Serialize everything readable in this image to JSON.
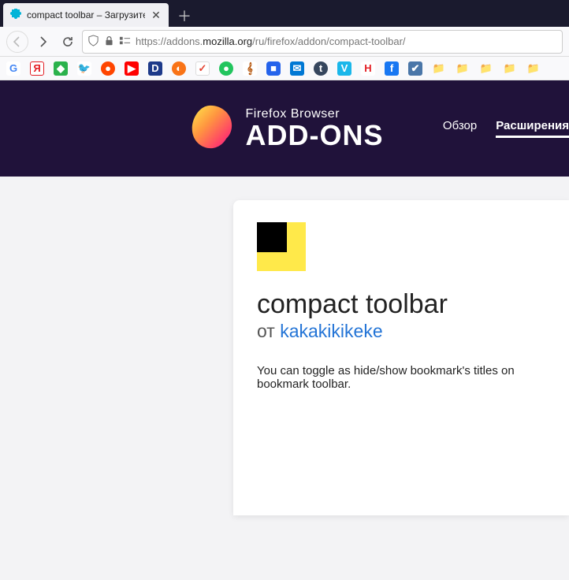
{
  "tab": {
    "title": "compact toolbar – Загрузите это"
  },
  "toolbar": {
    "url_prefix": "https://addons.",
    "url_domain": "mozilla.org",
    "url_path": "/ru/firefox/addon/compact-toolbar/"
  },
  "header": {
    "brand_line1": "Firefox Browser",
    "brand_line2": "ADD-ONS",
    "nav": {
      "overview": "Обзор",
      "extensions": "Расширения"
    }
  },
  "addon": {
    "title": "compact toolbar",
    "by": "от ",
    "author": "kakakikikeke",
    "description": "You can toggle as hide/show bookmark's titles on bookmark toolbar."
  },
  "bookmarks": [
    {
      "name": "google",
      "bg": "#fff",
      "fg": "#4285f4",
      "glyph": "G"
    },
    {
      "name": "yandex",
      "bg": "#fff",
      "fg": "#e31e24",
      "glyph": "Я",
      "border": "1px solid #e31e24"
    },
    {
      "name": "feedly",
      "bg": "#2bb24c",
      "fg": "#fff",
      "glyph": "◆"
    },
    {
      "name": "twitter",
      "bg": "#fff",
      "fg": "#1da1f2",
      "glyph": "🐦"
    },
    {
      "name": "reddit",
      "bg": "#ff4500",
      "fg": "#fff",
      "glyph": "●",
      "radius": "50%"
    },
    {
      "name": "youtube",
      "bg": "#ff0000",
      "fg": "#fff",
      "glyph": "▶"
    },
    {
      "name": "app-d",
      "bg": "#1e3a8a",
      "fg": "#fff",
      "glyph": "D"
    },
    {
      "name": "app-orange",
      "bg": "#f97316",
      "fg": "#fff",
      "glyph": "◐",
      "radius": "50%"
    },
    {
      "name": "todoist",
      "bg": "#fff",
      "fg": "#e44332",
      "glyph": "✓",
      "border": "1px solid #ddd"
    },
    {
      "name": "app-green",
      "bg": "#22c55e",
      "fg": "#fff",
      "glyph": "●",
      "radius": "50%"
    },
    {
      "name": "app-bars",
      "bg": "#fff",
      "fg": "#b45309",
      "glyph": "𝄞"
    },
    {
      "name": "app-blue",
      "bg": "#2563eb",
      "fg": "#fff",
      "glyph": "■",
      "radius": "4px"
    },
    {
      "name": "outlook",
      "bg": "#0078d4",
      "fg": "#fff",
      "glyph": "✉"
    },
    {
      "name": "tumblr",
      "bg": "#36465d",
      "fg": "#fff",
      "glyph": "t",
      "radius": "50%"
    },
    {
      "name": "vimeo",
      "bg": "#1ab7ea",
      "fg": "#fff",
      "glyph": "V"
    },
    {
      "name": "habr",
      "bg": "#fff",
      "fg": "#e31e24",
      "glyph": "H"
    },
    {
      "name": "facebook",
      "bg": "#1877f2",
      "fg": "#fff",
      "glyph": "f"
    },
    {
      "name": "vk",
      "bg": "#4a76a8",
      "fg": "#fff",
      "glyph": "✔"
    },
    {
      "name": "folder-1",
      "glyph": "📁",
      "folder": true
    },
    {
      "name": "folder-2",
      "glyph": "📁",
      "folder": true
    },
    {
      "name": "folder-3",
      "glyph": "📁",
      "folder": true
    },
    {
      "name": "folder-4",
      "glyph": "📁",
      "folder": true
    },
    {
      "name": "folder-5",
      "glyph": "📁",
      "folder": true
    }
  ]
}
